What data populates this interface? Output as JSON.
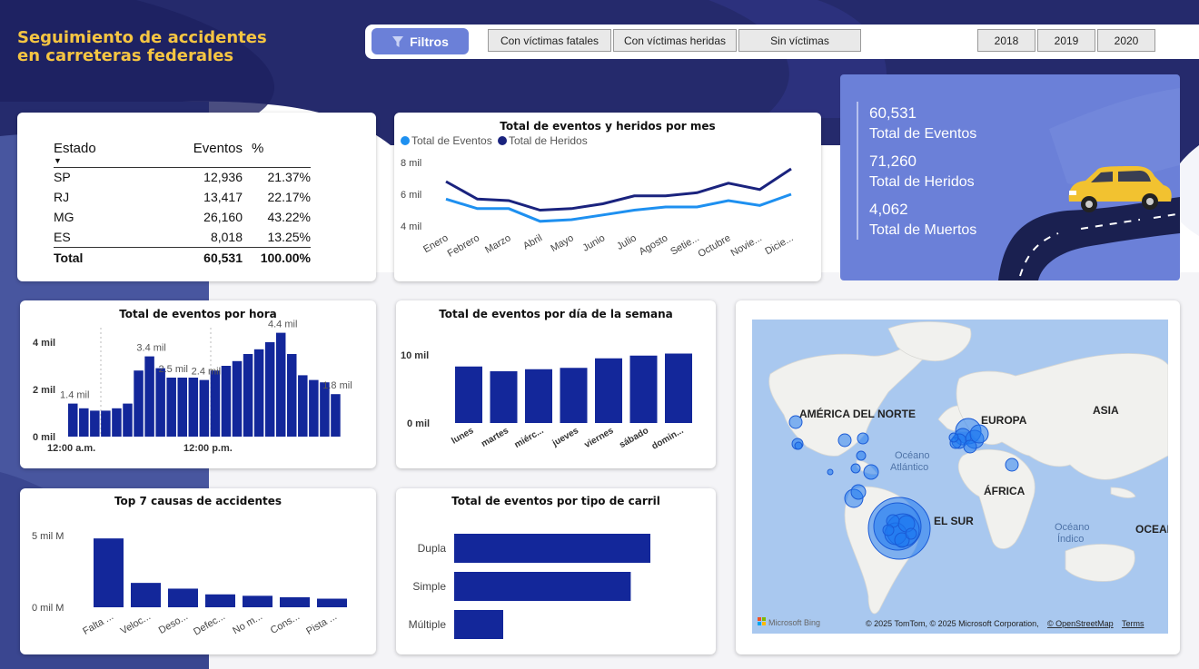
{
  "header": {
    "title_line1": "Seguimiento de accidentes",
    "title_line2": "en carreteras federales",
    "filtros_label": "Filtros",
    "victim_filters": [
      "Con víctimas fatales",
      "Con víctimas heridas",
      "Sin víctimas"
    ],
    "years": [
      "2018",
      "2019",
      "2020"
    ]
  },
  "estado_table": {
    "headers": [
      "Estado",
      "Eventos",
      "%"
    ],
    "rows": [
      [
        "SP",
        "12,936",
        "21.37%"
      ],
      [
        "RJ",
        "13,417",
        "22.17%"
      ],
      [
        "MG",
        "26,160",
        "43.22%"
      ],
      [
        "ES",
        "8,018",
        "13.25%"
      ]
    ],
    "total": [
      "Total",
      "60,531",
      "100.00%"
    ]
  },
  "kpis": {
    "eventos_value": "60,531",
    "eventos_label": "Total de Eventos",
    "heridos_value": "71,260",
    "heridos_label": "Total de Heridos",
    "muertos_value": "4,062",
    "muertos_label": "Total de Muertos"
  },
  "colors": {
    "dark_navy": "#1a237e",
    "bar_blue": "#13279a",
    "light_line": "#1e90f0",
    "accent": "#f5c542",
    "kpi_bg": "#6b80d8"
  },
  "chart_data": [
    {
      "type": "line",
      "title": "Total de eventos y heridos por mes",
      "categories": [
        "Enero",
        "Febrero",
        "Marzo",
        "Abril",
        "Mayo",
        "Junio",
        "Julio",
        "Agosto",
        "Setie...",
        "Octubre",
        "Novie...",
        "Dicie..."
      ],
      "series": [
        {
          "name": "Total de Eventos",
          "values": [
            5.7,
            5.1,
            5.1,
            4.3,
            4.4,
            4.7,
            5.0,
            5.2,
            5.2,
            5.6,
            5.3,
            6.0
          ]
        },
        {
          "name": "Total de Heridos",
          "values": [
            6.8,
            5.7,
            5.6,
            5.0,
            5.1,
            5.4,
            5.9,
            5.9,
            6.1,
            6.7,
            6.3,
            7.6
          ]
        }
      ],
      "ytick_labels": [
        "4 mil",
        "6 mil",
        "8 mil"
      ],
      "ylim": [
        4,
        8
      ]
    },
    {
      "type": "bar",
      "title": "Total de eventos por hora",
      "values": [
        1.4,
        1.2,
        1.1,
        1.1,
        1.2,
        1.4,
        2.8,
        3.4,
        2.9,
        2.5,
        2.5,
        2.5,
        2.4,
        2.8,
        3.0,
        3.2,
        3.5,
        3.7,
        4.0,
        4.4,
        3.5,
        2.6,
        2.4,
        2.3,
        1.8
      ],
      "data_labels": [
        {
          "index": 0,
          "text": "1.4 mil"
        },
        {
          "index": 7,
          "text": "3.4 mil"
        },
        {
          "index": 9,
          "text": "2.5 mil"
        },
        {
          "index": 12,
          "text": "2.4 mil"
        },
        {
          "index": 19,
          "text": "4.4 mil"
        },
        {
          "index": 24,
          "text": "1.8 mil"
        }
      ],
      "ytick_labels": [
        "0 mil",
        "2 mil",
        "4 mil"
      ],
      "xtick_labels": [
        "12:00 a.m.",
        "12:00 p.m."
      ],
      "ylim": [
        0,
        5
      ]
    },
    {
      "type": "bar",
      "title": "Total de eventos por día de la semana",
      "categories": [
        "lunes",
        "martes",
        "miérc...",
        "jueves",
        "viernes",
        "sábado",
        "domin..."
      ],
      "values": [
        8.3,
        7.6,
        7.9,
        8.1,
        9.5,
        9.9,
        10.2
      ],
      "ytick_labels": [
        "0 mil",
        "10 mil"
      ],
      "ylim": [
        0,
        11
      ]
    },
    {
      "type": "bar",
      "title": "Top 7 causas de accidentes",
      "categories": [
        "Falta ...",
        "Veloc...",
        "Deso...",
        "Defec...",
        "No m...",
        "Cons...",
        "Pista ..."
      ],
      "values": [
        4.8,
        1.7,
        1.3,
        0.9,
        0.8,
        0.7,
        0.6
      ],
      "ytick_labels": [
        "0 mil M",
        "5 mil M"
      ],
      "ylim": [
        0,
        5
      ]
    },
    {
      "type": "bar",
      "title": "Total de eventos por tipo de carril",
      "categories": [
        "Dupla",
        "Simple",
        "Múltiple"
      ],
      "values": [
        30,
        27,
        7.5
      ],
      "xlim": [
        0,
        40
      ]
    }
  ],
  "map": {
    "labels": [
      "AMÉRICA DEL NORTE",
      "EUROPA",
      "ASIA",
      "ÁFRICA",
      "Océano Atlántico",
      "EL SUR",
      "Océano Índico",
      "OCEAN"
    ],
    "atlantic_line1": "Océano",
    "atlantic_line2": "Atlántico",
    "indico_line1": "Océano",
    "indico_line2": "Índico",
    "bing_logo": "Microsoft Bing",
    "attribution": "© 2025 TomTom, © 2025 Microsoft Corporation,",
    "osm_link": "© OpenStreetMap",
    "terms_link": "Terms"
  }
}
